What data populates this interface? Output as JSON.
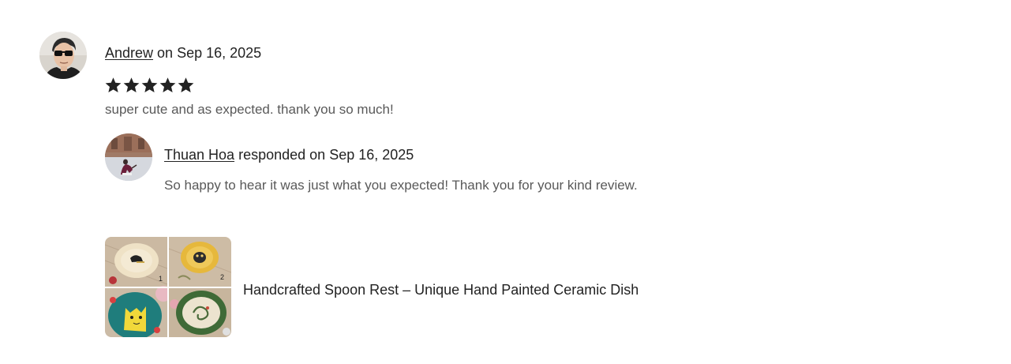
{
  "review": {
    "reviewer_name": "Andrew",
    "date_prefix": "on",
    "date": "Sep 16, 2025",
    "rating": 5,
    "rating_max": 5,
    "text": "super cute and as expected. thank you so much!"
  },
  "response": {
    "seller_name": "Thuan Hoa",
    "responded_prefix": "responded on",
    "date": "Sep 16, 2025",
    "text": "So happy to hear it was just what you expected! Thank you for your kind review."
  },
  "product": {
    "title": "Handcrafted Spoon Rest – Unique Hand Painted Ceramic Dish",
    "thumbnail_labels": [
      "1",
      "2"
    ]
  },
  "colors": {
    "text_primary": "#222222",
    "text_secondary": "#595959",
    "star": "#222222"
  },
  "icons": {
    "star": "star-filled-icon"
  }
}
